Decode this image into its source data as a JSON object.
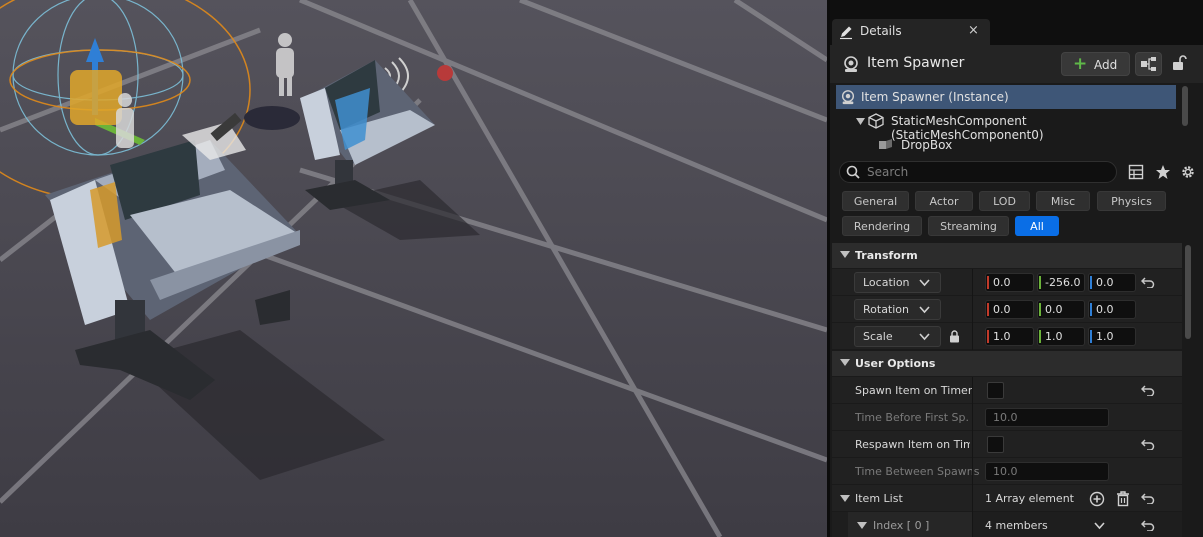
{
  "details_tab": {
    "label": "Details",
    "close": "×"
  },
  "header": {
    "title": "Item Spawner",
    "add_label": "Add"
  },
  "components": {
    "items": [
      {
        "label": "Item Spawner (Instance)"
      },
      {
        "label": "StaticMeshComponent (StaticMeshComponent0)"
      },
      {
        "label": "DropBox"
      }
    ]
  },
  "search": {
    "placeholder": "Search"
  },
  "filters": [
    "General",
    "Actor",
    "LOD",
    "Misc",
    "Physics",
    "Rendering",
    "Streaming",
    "All"
  ],
  "active_filter": "All",
  "transform": {
    "title": "Transform",
    "location": {
      "label": "Location",
      "x": "0.0",
      "y": "-256.0",
      "z": "0.0"
    },
    "rotation": {
      "label": "Rotation",
      "x": "0.0",
      "y": "0.0",
      "z": "0.0"
    },
    "scale": {
      "label": "Scale",
      "x": "1.0",
      "y": "1.0",
      "z": "1.0"
    }
  },
  "user_options": {
    "title": "User Options",
    "spawn_on_timer": {
      "label": "Spawn Item on Timer",
      "checked": false
    },
    "time_before_first": {
      "label": "Time Before First Sp...",
      "value": "10.0"
    },
    "respawn_on_timer": {
      "label": "Respawn Item on Tim...",
      "checked": false
    },
    "time_between": {
      "label": "Time Between Spawns",
      "value": "10.0"
    },
    "item_list": {
      "label": "Item List",
      "value": "1 Array element"
    },
    "index0": {
      "label": "Index [ 0 ]",
      "value": "4 members"
    }
  },
  "colors": {
    "accent": "#0a6ee6",
    "axis_x": "#c23a2a",
    "axis_y": "#6bb33a",
    "axis_z": "#2f7fd6",
    "selection": "#3e5677"
  },
  "icons": [
    "pencil-icon",
    "close-icon",
    "actor-icon",
    "plus-icon",
    "blueprint-icon",
    "lock-icon",
    "mesh-icon",
    "search-icon",
    "grid-icon",
    "star-icon",
    "gear-icon",
    "reset-icon",
    "chevron-down-icon",
    "add-element-icon",
    "trash-icon"
  ]
}
